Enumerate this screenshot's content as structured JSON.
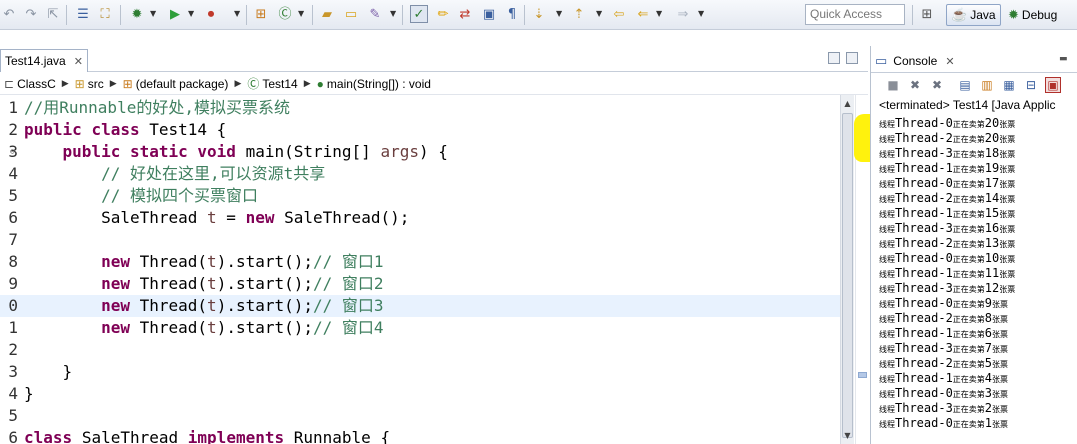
{
  "toolbar": {
    "quick_access_placeholder": "Quick Access",
    "perspectives": [
      {
        "label": "Java",
        "icon": "java-perspective-icon",
        "active": true
      },
      {
        "label": "Debug",
        "icon": "debug-perspective-icon",
        "active": false
      }
    ]
  },
  "editor": {
    "tab_label": "Test14.java",
    "tab_close": "✕",
    "breadcrumb": [
      {
        "label": "ClassC",
        "icon": "project-icon"
      },
      {
        "label": "src",
        "icon": "source-folder-icon"
      },
      {
        "label": "(default package)",
        "icon": "package-icon"
      },
      {
        "label": "Test14",
        "icon": "class-icon"
      },
      {
        "label": "main(String[]) : void",
        "icon": "method-icon"
      }
    ],
    "lines": [
      {
        "num": "1",
        "text": "//用Runnable的好处,模拟买票系统"
      },
      {
        "num": "2",
        "text": "public class Test14 {"
      },
      {
        "num": "3",
        "text": "    public static void main(String[] args) {"
      },
      {
        "num": "4",
        "text": "        // 好处在这里,可以资源t共享"
      },
      {
        "num": "5",
        "text": "        // 模拟四个买票窗口"
      },
      {
        "num": "6",
        "text": "        SaleThread t = new SaleThread();"
      },
      {
        "num": "7",
        "text": ""
      },
      {
        "num": "8",
        "text": "        new Thread(t).start();// 窗口1"
      },
      {
        "num": "9",
        "text": "        new Thread(t).start();// 窗口2"
      },
      {
        "num": "0",
        "text": "        new Thread(t).start();// 窗口3"
      },
      {
        "num": "1",
        "text": "        new Thread(t).start();// 窗口4"
      },
      {
        "num": "2",
        "text": ""
      },
      {
        "num": "3",
        "text": "    }"
      },
      {
        "num": "4",
        "text": "}"
      },
      {
        "num": "5",
        "text": ""
      },
      {
        "num": "6",
        "text": "class SaleThread implements Runnable {"
      }
    ],
    "current_line_index": 9
  },
  "console": {
    "tab_label": "Console",
    "tab_close": "✕",
    "status": "<terminated> Test14 [Java Applic",
    "output": [
      {
        "prefix": "线程",
        "thread": "Thread-0",
        "mid": "正在卖第",
        "num": "20",
        "suffix": "张票"
      },
      {
        "prefix": "线程",
        "thread": "Thread-2",
        "mid": "正在卖第",
        "num": "20",
        "suffix": "张票"
      },
      {
        "prefix": "线程",
        "thread": "Thread-3",
        "mid": "正在卖第",
        "num": "18",
        "suffix": "张票"
      },
      {
        "prefix": "线程",
        "thread": "Thread-1",
        "mid": "正在卖第",
        "num": "19",
        "suffix": "张票"
      },
      {
        "prefix": "线程",
        "thread": "Thread-0",
        "mid": "正在卖第",
        "num": "17",
        "suffix": "张票"
      },
      {
        "prefix": "线程",
        "thread": "Thread-2",
        "mid": "正在卖第",
        "num": "14",
        "suffix": "张票"
      },
      {
        "prefix": "线程",
        "thread": "Thread-1",
        "mid": "正在卖第",
        "num": "15",
        "suffix": "张票"
      },
      {
        "prefix": "线程",
        "thread": "Thread-3",
        "mid": "正在卖第",
        "num": "16",
        "suffix": "张票"
      },
      {
        "prefix": "线程",
        "thread": "Thread-2",
        "mid": "正在卖第",
        "num": "13",
        "suffix": "张票"
      },
      {
        "prefix": "线程",
        "thread": "Thread-0",
        "mid": "正在卖第",
        "num": "10",
        "suffix": "张票"
      },
      {
        "prefix": "线程",
        "thread": "Thread-1",
        "mid": "正在卖第",
        "num": "11",
        "suffix": "张票"
      },
      {
        "prefix": "线程",
        "thread": "Thread-3",
        "mid": "正在卖第",
        "num": "12",
        "suffix": "张票"
      },
      {
        "prefix": "线程",
        "thread": "Thread-0",
        "mid": "正在卖第",
        "num": "9",
        "suffix": "张票"
      },
      {
        "prefix": "线程",
        "thread": "Thread-2",
        "mid": "正在卖第",
        "num": "8",
        "suffix": "张票"
      },
      {
        "prefix": "线程",
        "thread": "Thread-1",
        "mid": "正在卖第",
        "num": "6",
        "suffix": "张票"
      },
      {
        "prefix": "线程",
        "thread": "Thread-3",
        "mid": "正在卖第",
        "num": "7",
        "suffix": "张票"
      },
      {
        "prefix": "线程",
        "thread": "Thread-2",
        "mid": "正在卖第",
        "num": "5",
        "suffix": "张票"
      },
      {
        "prefix": "线程",
        "thread": "Thread-1",
        "mid": "正在卖第",
        "num": "4",
        "suffix": "张票"
      },
      {
        "prefix": "线程",
        "thread": "Thread-0",
        "mid": "正在卖第",
        "num": "3",
        "suffix": "张票"
      },
      {
        "prefix": "线程",
        "thread": "Thread-3",
        "mid": "正在卖第",
        "num": "2",
        "suffix": "张票"
      },
      {
        "prefix": "线程",
        "thread": "Thread-0",
        "mid": "正在卖第",
        "num": "1",
        "suffix": "张票"
      }
    ]
  },
  "colors": {
    "keyword": "#7f0055",
    "comment": "#3f7f5f",
    "highlight": "#fff100",
    "current_line": "#e8f2fe"
  }
}
